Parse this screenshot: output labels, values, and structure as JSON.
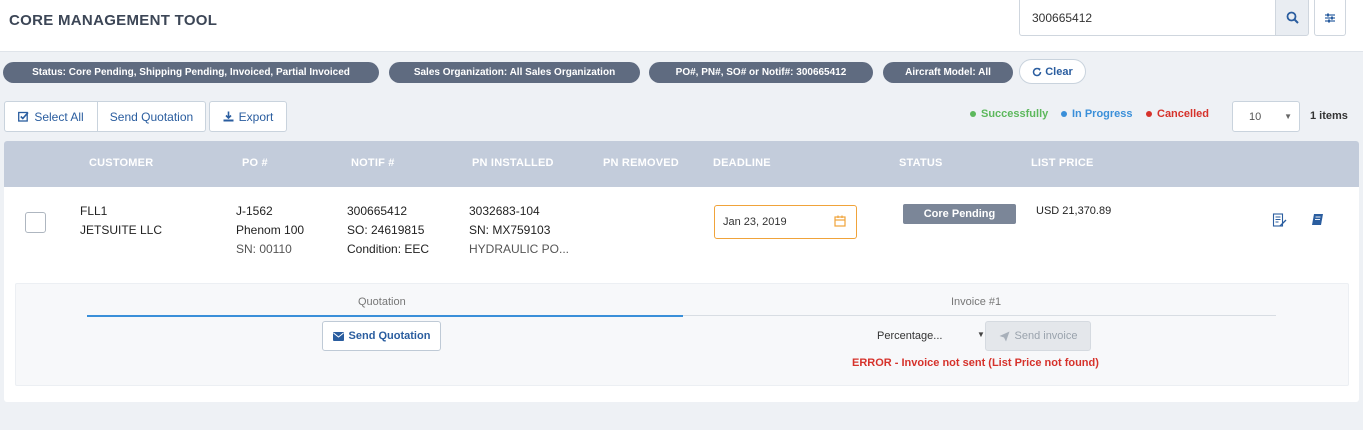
{
  "app": {
    "title": "CORE MANAGEMENT TOOL"
  },
  "search": {
    "value": "300665412",
    "placeholder": ""
  },
  "icons": {
    "search": "search-icon",
    "filter": "sliders-icon",
    "refresh": "refresh-icon",
    "check": "check-square-icon",
    "download": "download-icon",
    "calendar": "calendar-icon",
    "edit": "edit-list-icon",
    "book": "book-icon",
    "envelope": "envelope-icon",
    "send": "paper-plane-icon"
  },
  "filters": [
    {
      "label": "Status: Core Pending, Shipping Pending, Invoiced, Partial Invoiced"
    },
    {
      "label": "Sales Organization: All Sales Organization"
    },
    {
      "label": "PO#, PN#, SO# or Notif#: 300665412"
    },
    {
      "label": "Aircraft Model: All"
    }
  ],
  "clear_label": "Clear",
  "toolbar": {
    "select_all": "Select All",
    "send_quotation": "Send Quotation",
    "export": "Export"
  },
  "legend": [
    {
      "label": "Successfully",
      "color": "#5cb85c"
    },
    {
      "label": "In Progress",
      "color": "#3a8fd9"
    },
    {
      "label": "Cancelled",
      "color": "#d6322b"
    }
  ],
  "pagination": {
    "page_size": "10",
    "items": "1 items"
  },
  "table": {
    "headers": [
      "CUSTOMER",
      "PO #",
      "NOTIF #",
      "PN INSTALLED",
      "PN REMOVED",
      "DEADLINE",
      "STATUS",
      "LIST PRICE"
    ],
    "row": {
      "customer_code": "FLL1",
      "customer_name": "JETSUITE LLC",
      "po": "J-1562",
      "model": "Phenom 100",
      "sn": "SN: 00110",
      "notif": "300665412",
      "so": "SO: 24619815",
      "condition": "Condition: EEC",
      "pn_installed": "3032683-104",
      "pn_sn": "SN: MX759103",
      "pn_desc": "HYDRAULIC PO...",
      "pn_removed": "",
      "deadline": "Jan 23, 2019",
      "status": "Core Pending",
      "list_price": "USD 21,370.89"
    }
  },
  "subpanel": {
    "tabs": [
      "Quotation",
      "Invoice #1"
    ],
    "send_quotation": "Send Quotation",
    "invoice_type": "Percentage...",
    "send_invoice": "Send invoice",
    "error": "ERROR - Invoice not sent (List Price not found)"
  }
}
